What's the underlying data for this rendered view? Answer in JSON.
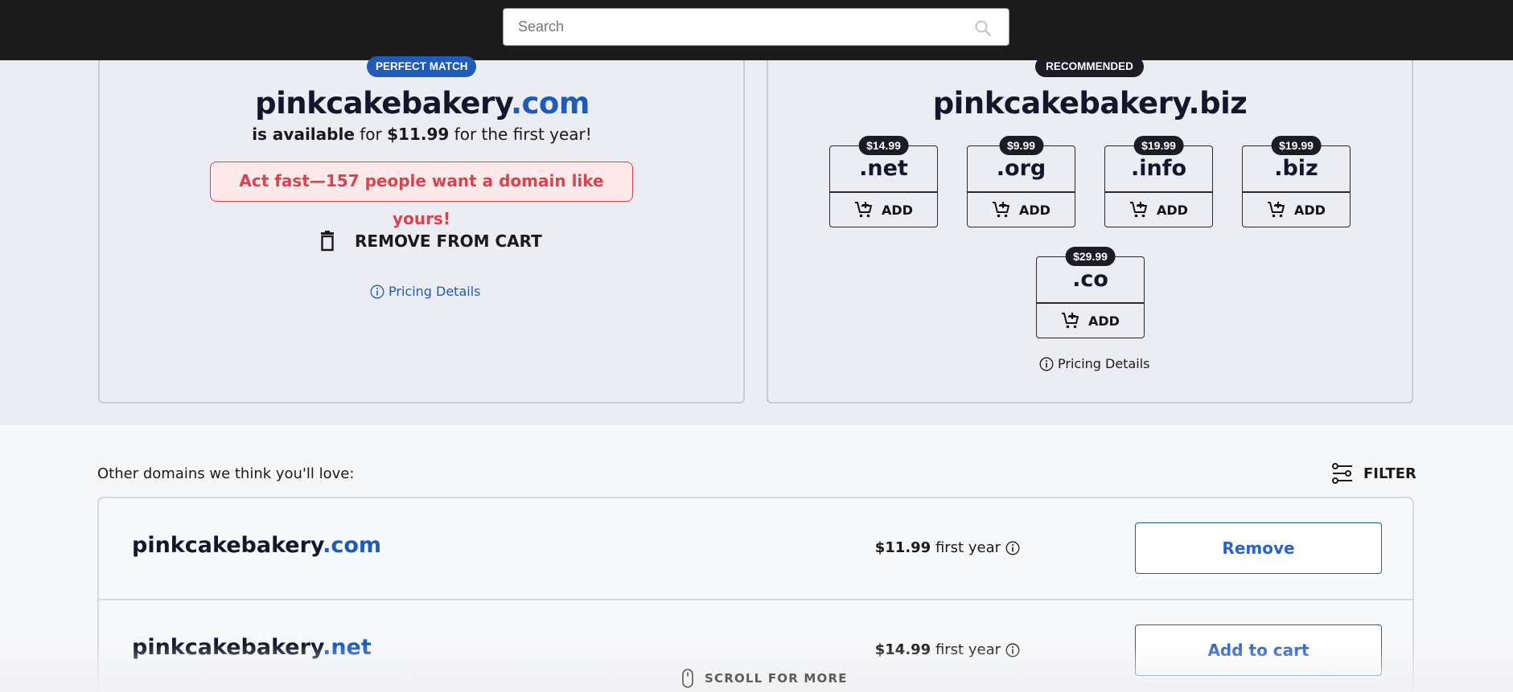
{
  "search": {
    "placeholder": "Search"
  },
  "hero": {
    "perfect_match": {
      "badge": "PERFECT MATCH",
      "domain_sld": "pinkcakebakery",
      "domain_tld": ".com",
      "availability": {
        "prefix": "is available",
        "for1": " for ",
        "price": "$11.99",
        "suffix": " for the first year!"
      },
      "urgency": "Act fast—157 people want a domain like yours!",
      "remove_label": "REMOVE FROM CART",
      "pricing_details": "Pricing Details"
    },
    "recommended": {
      "badge": "RECOMMENDED",
      "domain": "pinkcakebakery.biz",
      "tlds": [
        {
          "ext": ".net",
          "price": "$14.99",
          "add": "ADD"
        },
        {
          "ext": ".org",
          "price": "$9.99",
          "add": "ADD"
        },
        {
          "ext": ".info",
          "price": "$19.99",
          "add": "ADD"
        },
        {
          "ext": ".biz",
          "price": "$19.99",
          "add": "ADD"
        },
        {
          "ext": ".co",
          "price": "$29.99",
          "add": "ADD"
        }
      ],
      "pricing_details": "Pricing Details"
    }
  },
  "other": {
    "label": "Other domains we think you'll love:",
    "filter_label": "FILTER",
    "rows": [
      {
        "sld": "pinkcakebakery",
        "tld": ".com",
        "price": "$11.99",
        "term": " first year",
        "action": "Remove"
      },
      {
        "sld": "pinkcakebakery",
        "tld": ".net",
        "price": "$14.99",
        "term": " first year",
        "action": "Add to cart"
      }
    ]
  },
  "scroll_hint": "SCROLL FOR MORE",
  "colors": {
    "brand_blue": "#1f5bb8",
    "alert_red": "#d9434f",
    "dark": "#1c1c24"
  },
  "icons": [
    "search-icon",
    "trash-icon",
    "info-icon",
    "cart-plus-icon",
    "filter-icon",
    "mouse-icon"
  ]
}
